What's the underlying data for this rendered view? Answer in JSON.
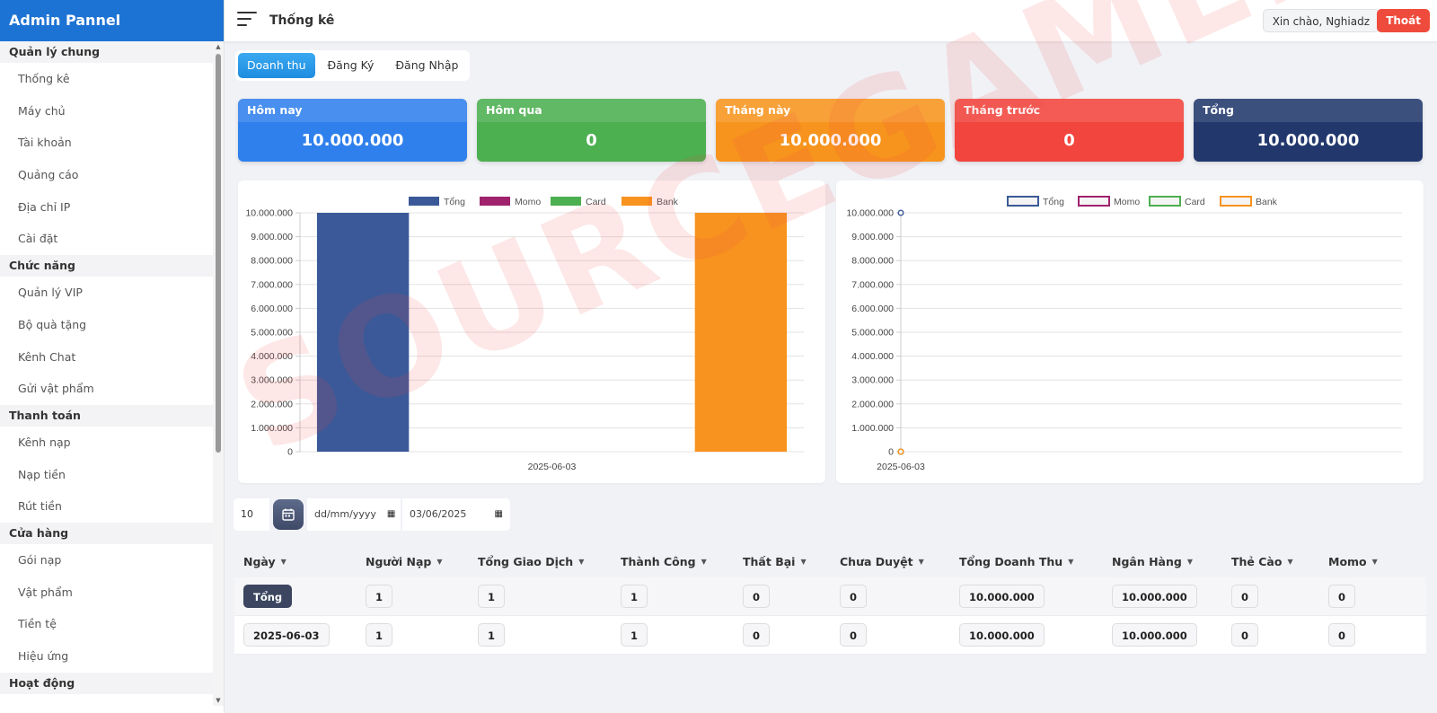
{
  "brand": "Admin Pannel",
  "page_title": "Thống kê",
  "greeting": "Xin chào, Nghiadz",
  "logout": "Thoát",
  "sidebar": [
    {
      "group": "Quản lý chung",
      "items": [
        "Thống kê",
        "Máy chủ",
        "Tài khoản",
        "Quảng cáo",
        "Địa chỉ IP",
        "Cài đặt"
      ]
    },
    {
      "group": "Chức năng",
      "items": [
        "Quản lý VIP",
        "Bộ quà tặng",
        "Kênh Chat",
        "Gửi vật phẩm"
      ]
    },
    {
      "group": "Thanh toán",
      "items": [
        "Kênh nạp",
        "Nạp tiền",
        "Rút tiền"
      ]
    },
    {
      "group": "Cửa hàng",
      "items": [
        "Gói nạp",
        "Vật phẩm",
        "Tiền tệ",
        "Hiệu ứng"
      ]
    },
    {
      "group": "Hoạt động",
      "items": []
    }
  ],
  "tabs": [
    {
      "label": "Doanh thu",
      "active": true
    },
    {
      "label": "Đăng Ký",
      "active": false
    },
    {
      "label": "Đăng Nhập",
      "active": false
    }
  ],
  "cards": [
    {
      "label": "Hôm nay",
      "value": "10.000.000",
      "color": "#2f80ed"
    },
    {
      "label": "Hôm qua",
      "value": "0",
      "color": "#4caf50"
    },
    {
      "label": "Tháng này",
      "value": "10.000.000",
      "color": "#f7941d"
    },
    {
      "label": "Tháng trước",
      "value": "0",
      "color": "#f2453d"
    },
    {
      "label": "Tổng",
      "value": "10.000.000",
      "color": "#22386d"
    }
  ],
  "chart_data": [
    {
      "type": "bar",
      "categories": [
        "2025-06-03"
      ],
      "series": [
        {
          "name": "Tổng",
          "values": [
            10000000
          ],
          "color": "#3b5998"
        },
        {
          "name": "Momo",
          "values": [
            0
          ],
          "color": "#a0226d"
        },
        {
          "name": "Card",
          "values": [
            0
          ],
          "color": "#4caf50"
        },
        {
          "name": "Bank",
          "values": [
            10000000
          ],
          "color": "#f7931e"
        }
      ],
      "ylim": [
        0,
        10000000
      ],
      "yticks": [
        "0",
        "1.000.000",
        "2.000.000",
        "3.000.000",
        "4.000.000",
        "5.000.000",
        "6.000.000",
        "7.000.000",
        "8.000.000",
        "9.000.000",
        "10.000.000"
      ],
      "grid": true,
      "legend": "top-center"
    },
    {
      "type": "line",
      "categories": [
        "2025-06-03"
      ],
      "series": [
        {
          "name": "Tổng",
          "values": [
            10000000
          ],
          "color": "#3b5998"
        },
        {
          "name": "Momo",
          "values": [
            0
          ],
          "color": "#a0226d"
        },
        {
          "name": "Card",
          "values": [
            0
          ],
          "color": "#4caf50"
        },
        {
          "name": "Bank",
          "values": [
            0
          ],
          "color": "#f7931e"
        }
      ],
      "ylim": [
        0,
        10000000
      ],
      "yticks": [
        "0",
        "1.000.000",
        "2.000.000",
        "3.000.000",
        "4.000.000",
        "5.000.000",
        "6.000.000",
        "7.000.000",
        "8.000.000",
        "9.000.000",
        "10.000.000"
      ],
      "grid": true,
      "legend": "top-center"
    }
  ],
  "filters": {
    "page_size": "10",
    "date_from_placeholder": "dd/mm/yyyy",
    "date_to": "03/06/2025"
  },
  "table": {
    "columns": [
      "Ngày",
      "Người Nạp",
      "Tổng Giao Dịch",
      "Thành Công",
      "Thất Bại",
      "Chưa Duyệt",
      "Tổng Doanh Thu",
      "Ngân Hàng",
      "Thẻ Cào",
      "Momo"
    ],
    "rows": [
      [
        "Tổng",
        "1",
        "1",
        "1",
        "0",
        "0",
        "10.000.000",
        "10.000.000",
        "0",
        "0"
      ],
      [
        "2025-06-03",
        "1",
        "1",
        "1",
        "0",
        "0",
        "10.000.000",
        "10.000.000",
        "0",
        "0"
      ]
    ]
  },
  "watermark": "SOURCEGAME.VN"
}
